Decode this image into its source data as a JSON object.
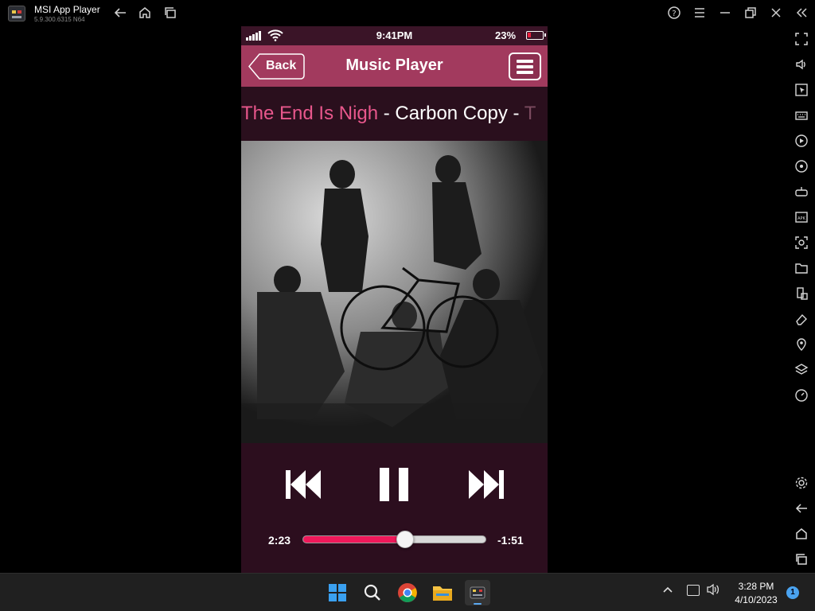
{
  "emulator": {
    "title": "MSI App Player",
    "version": "5.9.300.6315  N64"
  },
  "phone": {
    "status": {
      "time": "9:41PM",
      "battery_pct": "23%"
    },
    "nav": {
      "back_label": "Back",
      "title": "Music Player"
    },
    "now_playing": {
      "song": "The End Is Nigh",
      "separator": " - ",
      "artist": "Carbon Copy",
      "separator2": " - ",
      "next_fragment": "T"
    },
    "player": {
      "elapsed": "2:23",
      "remaining": "-1:51",
      "progress_fraction": 0.56,
      "state": "playing"
    }
  },
  "taskbar": {
    "clock_time": "3:28 PM",
    "clock_date": "4/10/2023",
    "notification_count": "1"
  },
  "colors": {
    "nav_bar": "#a23a5e",
    "song_title": "#e8578c",
    "progress_fill": "#f0185a",
    "screen_bg": "#2a0f1d"
  }
}
